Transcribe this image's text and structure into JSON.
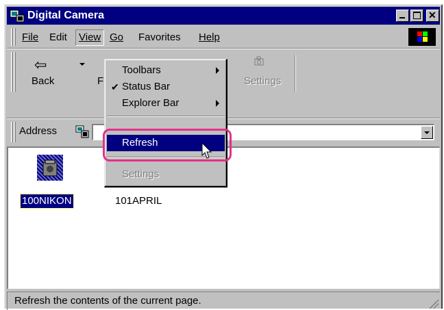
{
  "window": {
    "title": "Digital Camera"
  },
  "menubar": {
    "items": [
      "File",
      "Edit",
      "View",
      "Go",
      "Favorites",
      "Help"
    ]
  },
  "toolbar": {
    "back_label": "Back",
    "forward_label_partial": "F",
    "settings_label": "Settings"
  },
  "address": {
    "label": "Address"
  },
  "view_menu": {
    "items": [
      {
        "label": "Toolbars",
        "submenu": true
      },
      {
        "label": "Status Bar",
        "checked": true
      },
      {
        "label": "Explorer Bar",
        "submenu": true
      },
      {
        "label": "Refresh",
        "highlighted": true
      },
      {
        "label": "Settings",
        "disabled": true
      }
    ]
  },
  "content": {
    "files": [
      {
        "name": "100NIKON",
        "selected": true
      },
      {
        "name": "101APRIL",
        "selected": false
      }
    ]
  },
  "status": {
    "text": "Refresh the contents of the current page."
  },
  "colors": {
    "titlebar": "#000080",
    "window_face": "#c0c0c0",
    "highlight_ring": "#e2308a"
  }
}
